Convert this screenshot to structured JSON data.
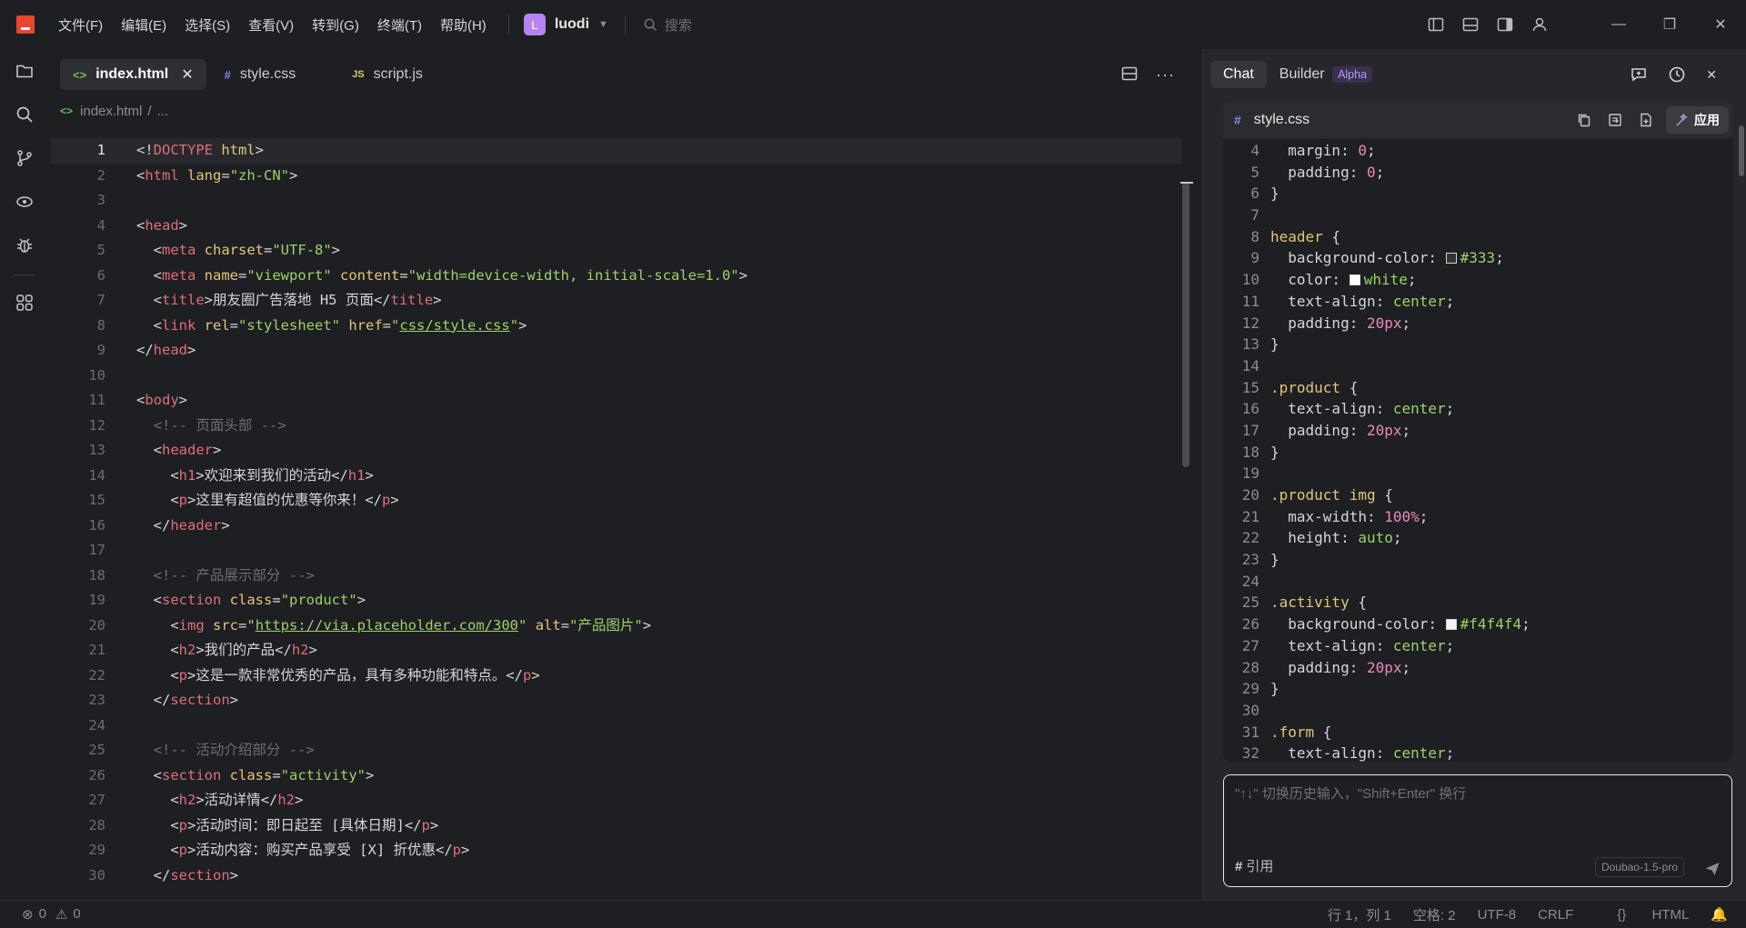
{
  "menu": [
    "文件(F)",
    "编辑(E)",
    "选择(S)",
    "查看(V)",
    "转到(G)",
    "终端(T)",
    "帮助(H)"
  ],
  "workspace": {
    "avatar": "L",
    "name": "luodi"
  },
  "search": {
    "placeholder": "搜索"
  },
  "colors": {
    "accent": "#b584f0",
    "brand": "#e8452d",
    "string": "#9bd26a",
    "tag": "#e16d79",
    "attr": "#e4c57a"
  },
  "editor": {
    "tabs": [
      {
        "icon": "<>",
        "label": "index.html",
        "active": true
      },
      {
        "icon": "#",
        "label": "style.css"
      },
      {
        "icon": "JS",
        "label": "script.js"
      }
    ],
    "breadcrumb": {
      "file": "index.html",
      "sep": "/",
      "more": "..."
    },
    "lines": [
      [
        [
          "t-p",
          "<!"
        ],
        [
          "t-doct",
          "DOCTYPE"
        ],
        [
          "t-p",
          " "
        ],
        [
          "t-doc2",
          "html"
        ],
        [
          "t-p",
          ">"
        ]
      ],
      [
        [
          "t-p",
          "<"
        ],
        [
          "t-tag",
          "html"
        ],
        [
          "t-p",
          " "
        ],
        [
          "t-attr",
          "lang"
        ],
        [
          "t-p",
          "="
        ],
        [
          "t-str",
          "\"zh-CN\""
        ],
        [
          "t-p",
          ">"
        ]
      ],
      [],
      [
        [
          "t-p",
          "<"
        ],
        [
          "t-tag",
          "head"
        ],
        [
          "t-p",
          ">"
        ]
      ],
      [
        [
          "t-p",
          "  <"
        ],
        [
          "t-tag",
          "meta"
        ],
        [
          "t-p",
          " "
        ],
        [
          "t-attr",
          "charset"
        ],
        [
          "t-p",
          "="
        ],
        [
          "t-str",
          "\"UTF-8\""
        ],
        [
          "t-p",
          ">"
        ]
      ],
      [
        [
          "t-p",
          "  <"
        ],
        [
          "t-tag",
          "meta"
        ],
        [
          "t-p",
          " "
        ],
        [
          "t-attr",
          "name"
        ],
        [
          "t-p",
          "="
        ],
        [
          "t-str",
          "\"viewport\""
        ],
        [
          "t-p",
          " "
        ],
        [
          "t-attr",
          "content"
        ],
        [
          "t-p",
          "="
        ],
        [
          "t-str",
          "\"width=device-width, initial-scale=1.0\""
        ],
        [
          "t-p",
          ">"
        ]
      ],
      [
        [
          "t-p",
          "  <"
        ],
        [
          "t-tag",
          "title"
        ],
        [
          "t-p",
          ">朋友圈广告落地 H5 页面</"
        ],
        [
          "t-tag",
          "title"
        ],
        [
          "t-p",
          ">"
        ]
      ],
      [
        [
          "t-p",
          "  <"
        ],
        [
          "t-tag",
          "link"
        ],
        [
          "t-p",
          " "
        ],
        [
          "t-attr",
          "rel"
        ],
        [
          "t-p",
          "="
        ],
        [
          "t-str",
          "\"stylesheet\""
        ],
        [
          "t-p",
          " "
        ],
        [
          "t-attr",
          "href"
        ],
        [
          "t-p",
          "="
        ],
        [
          "t-str",
          "\""
        ],
        [
          "t-url",
          "css/style.css"
        ],
        [
          "t-str",
          "\""
        ],
        [
          "t-p",
          ">"
        ]
      ],
      [
        [
          "t-p",
          "</"
        ],
        [
          "t-tag",
          "head"
        ],
        [
          "t-p",
          ">"
        ]
      ],
      [],
      [
        [
          "t-p",
          "<"
        ],
        [
          "t-tag",
          "body"
        ],
        [
          "t-p",
          ">"
        ]
      ],
      [
        [
          "t-com",
          "  <!-- 页面头部 -->"
        ]
      ],
      [
        [
          "t-p",
          "  <"
        ],
        [
          "t-tag",
          "header"
        ],
        [
          "t-p",
          ">"
        ]
      ],
      [
        [
          "t-p",
          "    <"
        ],
        [
          "t-tag",
          "h1"
        ],
        [
          "t-p",
          ">欢迎来到我们的活动</"
        ],
        [
          "t-tag",
          "h1"
        ],
        [
          "t-p",
          ">"
        ]
      ],
      [
        [
          "t-p",
          "    <"
        ],
        [
          "t-tag",
          "p"
        ],
        [
          "t-p",
          ">这里有超值的优惠等你来！</"
        ],
        [
          "t-tag",
          "p"
        ],
        [
          "t-p",
          ">"
        ]
      ],
      [
        [
          "t-p",
          "  </"
        ],
        [
          "t-tag",
          "header"
        ],
        [
          "t-p",
          ">"
        ]
      ],
      [],
      [
        [
          "t-com",
          "  <!-- 产品展示部分 -->"
        ]
      ],
      [
        [
          "t-p",
          "  <"
        ],
        [
          "t-tag",
          "section"
        ],
        [
          "t-p",
          " "
        ],
        [
          "t-attr",
          "class"
        ],
        [
          "t-p",
          "="
        ],
        [
          "t-str",
          "\"product\""
        ],
        [
          "t-p",
          ">"
        ]
      ],
      [
        [
          "t-p",
          "    <"
        ],
        [
          "t-tag",
          "img"
        ],
        [
          "t-p",
          " "
        ],
        [
          "t-attr",
          "src"
        ],
        [
          "t-p",
          "="
        ],
        [
          "t-str",
          "\""
        ],
        [
          "t-url",
          "https://via.placeholder.com/300"
        ],
        [
          "t-str",
          "\""
        ],
        [
          "t-p",
          " "
        ],
        [
          "t-attr",
          "alt"
        ],
        [
          "t-p",
          "="
        ],
        [
          "t-str",
          "\"产品图片\""
        ],
        [
          "t-p",
          ">"
        ]
      ],
      [
        [
          "t-p",
          "    <"
        ],
        [
          "t-tag",
          "h2"
        ],
        [
          "t-p",
          ">我们的产品</"
        ],
        [
          "t-tag",
          "h2"
        ],
        [
          "t-p",
          ">"
        ]
      ],
      [
        [
          "t-p",
          "    <"
        ],
        [
          "t-tag",
          "p"
        ],
        [
          "t-p",
          ">这是一款非常优秀的产品，具有多种功能和特点。</"
        ],
        [
          "t-tag",
          "p"
        ],
        [
          "t-p",
          ">"
        ]
      ],
      [
        [
          "t-p",
          "  </"
        ],
        [
          "t-tag",
          "section"
        ],
        [
          "t-p",
          ">"
        ]
      ],
      [],
      [
        [
          "t-com",
          "  <!-- 活动介绍部分 -->"
        ]
      ],
      [
        [
          "t-p",
          "  <"
        ],
        [
          "t-tag",
          "section"
        ],
        [
          "t-p",
          " "
        ],
        [
          "t-attr",
          "class"
        ],
        [
          "t-p",
          "="
        ],
        [
          "t-str",
          "\"activity\""
        ],
        [
          "t-p",
          ">"
        ]
      ],
      [
        [
          "t-p",
          "    <"
        ],
        [
          "t-tag",
          "h2"
        ],
        [
          "t-p",
          ">活动详情</"
        ],
        [
          "t-tag",
          "h2"
        ],
        [
          "t-p",
          ">"
        ]
      ],
      [
        [
          "t-p",
          "    <"
        ],
        [
          "t-tag",
          "p"
        ],
        [
          "t-p",
          ">活动时间：即日起至 [具体日期]</"
        ],
        [
          "t-tag",
          "p"
        ],
        [
          "t-p",
          ">"
        ]
      ],
      [
        [
          "t-p",
          "    <"
        ],
        [
          "t-tag",
          "p"
        ],
        [
          "t-p",
          ">活动内容：购买产品享受 [X] 折优惠</"
        ],
        [
          "t-tag",
          "p"
        ],
        [
          "t-p",
          ">"
        ]
      ],
      [
        [
          "t-p",
          "  </"
        ],
        [
          "t-tag",
          "section"
        ],
        [
          "t-p",
          ">"
        ]
      ]
    ],
    "current_line": 1
  },
  "panel": {
    "tabs": [
      {
        "label": "Chat",
        "active": true
      },
      {
        "label": "Builder",
        "badge": "Alpha"
      }
    ],
    "code_card": {
      "file": "style.css",
      "apply_label": "应用",
      "first_line_number": 4,
      "lines": [
        [
          [
            "c-prop",
            "  margin: "
          ],
          [
            "c-num",
            "0"
          ],
          [
            "c-prop",
            ";"
          ]
        ],
        [
          [
            "c-prop",
            "  padding: "
          ],
          [
            "c-num",
            "0"
          ],
          [
            "c-prop",
            ";"
          ]
        ],
        [
          [
            "c-prop",
            "}"
          ]
        ],
        [],
        [
          [
            "c-sel",
            "header"
          ],
          [
            "c-prop",
            " {"
          ]
        ],
        [
          [
            "c-prop",
            "  background-color: "
          ],
          [
            "swatch",
            "#333333"
          ],
          [
            "c-hex",
            "#333"
          ],
          [
            "c-prop",
            ";"
          ]
        ],
        [
          [
            "c-prop",
            "  color: "
          ],
          [
            "swatch",
            "#ffffff"
          ],
          [
            "c-val",
            "white"
          ],
          [
            "c-prop",
            ";"
          ]
        ],
        [
          [
            "c-prop",
            "  text-align: "
          ],
          [
            "c-val",
            "center"
          ],
          [
            "c-prop",
            ";"
          ]
        ],
        [
          [
            "c-prop",
            "  padding: "
          ],
          [
            "c-num",
            "20px"
          ],
          [
            "c-prop",
            ";"
          ]
        ],
        [
          [
            "c-prop",
            "}"
          ]
        ],
        [],
        [
          [
            "c-sel",
            ".product"
          ],
          [
            "c-prop",
            " {"
          ]
        ],
        [
          [
            "c-prop",
            "  text-align: "
          ],
          [
            "c-val",
            "center"
          ],
          [
            "c-prop",
            ";"
          ]
        ],
        [
          [
            "c-prop",
            "  padding: "
          ],
          [
            "c-num",
            "20px"
          ],
          [
            "c-prop",
            ";"
          ]
        ],
        [
          [
            "c-prop",
            "}"
          ]
        ],
        [],
        [
          [
            "c-sel",
            ".product img"
          ],
          [
            "c-prop",
            " {"
          ]
        ],
        [
          [
            "c-prop",
            "  max-width: "
          ],
          [
            "c-num",
            "100%"
          ],
          [
            "c-prop",
            ";"
          ]
        ],
        [
          [
            "c-prop",
            "  height: "
          ],
          [
            "c-val",
            "auto"
          ],
          [
            "c-prop",
            ";"
          ]
        ],
        [
          [
            "c-prop",
            "}"
          ]
        ],
        [],
        [
          [
            "c-sel",
            ".activity"
          ],
          [
            "c-prop",
            " {"
          ]
        ],
        [
          [
            "c-prop",
            "  background-color: "
          ],
          [
            "swatch",
            "#f4f4f4"
          ],
          [
            "c-hex",
            "#f4f4f4"
          ],
          [
            "c-prop",
            ";"
          ]
        ],
        [
          [
            "c-prop",
            "  text-align: "
          ],
          [
            "c-val",
            "center"
          ],
          [
            "c-prop",
            ";"
          ]
        ],
        [
          [
            "c-prop",
            "  padding: "
          ],
          [
            "c-num",
            "20px"
          ],
          [
            "c-prop",
            ";"
          ]
        ],
        [
          [
            "c-prop",
            "}"
          ]
        ],
        [],
        [
          [
            "c-sel",
            ".form"
          ],
          [
            "c-prop",
            " {"
          ]
        ],
        [
          [
            "c-prop",
            "  text-align: "
          ],
          [
            "c-val",
            "center"
          ],
          [
            "c-prop",
            ";"
          ]
        ]
      ]
    },
    "chat": {
      "placeholder": "\"↑↓\" 切换历史输入，\"Shift+Enter\" 换行",
      "cite_label": "引用",
      "model": "Doubao-1.5-pro"
    }
  },
  "status": {
    "errors": "0",
    "warnings": "0",
    "position": "行 1，列 1",
    "indent": "空格: 2",
    "encoding": "UTF-8",
    "eol": "CRLF",
    "language": "HTML"
  }
}
